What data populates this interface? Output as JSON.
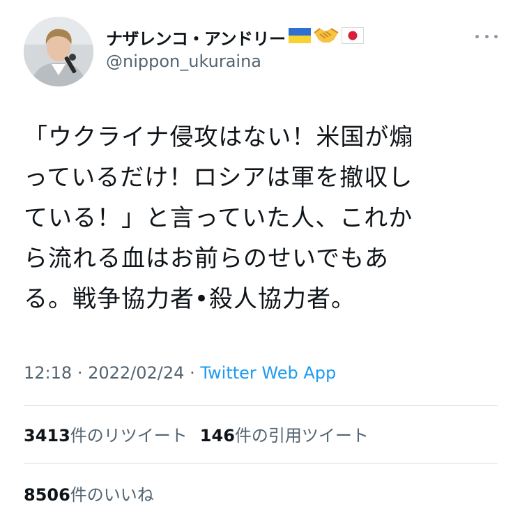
{
  "author": {
    "display_name": "ナザレンコ・アンドリー",
    "handle": "@nippon_ukuraina",
    "badges": [
      "ukraine-flag-icon",
      "handshake-icon",
      "japan-flag-icon"
    ]
  },
  "tweet": {
    "text": "「ウクライナ侵攻はない！米国が煽\nっているだけ！ロシアは軍を撤収し\nている！」と言っていた人、これか\nら流れる血はお前らのせいでもあ\nる。戦争協力者•殺人協力者。",
    "time": "12:18",
    "separator": "·",
    "date": "2022/02/24",
    "source": "Twitter Web App"
  },
  "stats": {
    "retweets": {
      "count": "3413",
      "label": "件のリツイート"
    },
    "quotes": {
      "count": "146",
      "label": "件の引用ツイート"
    },
    "likes": {
      "count": "8506",
      "label": "件のいいね"
    }
  },
  "colors": {
    "text": "#0f1419",
    "secondary": "#536471",
    "link": "#1d9bf0",
    "divider": "#dfe3e6"
  }
}
